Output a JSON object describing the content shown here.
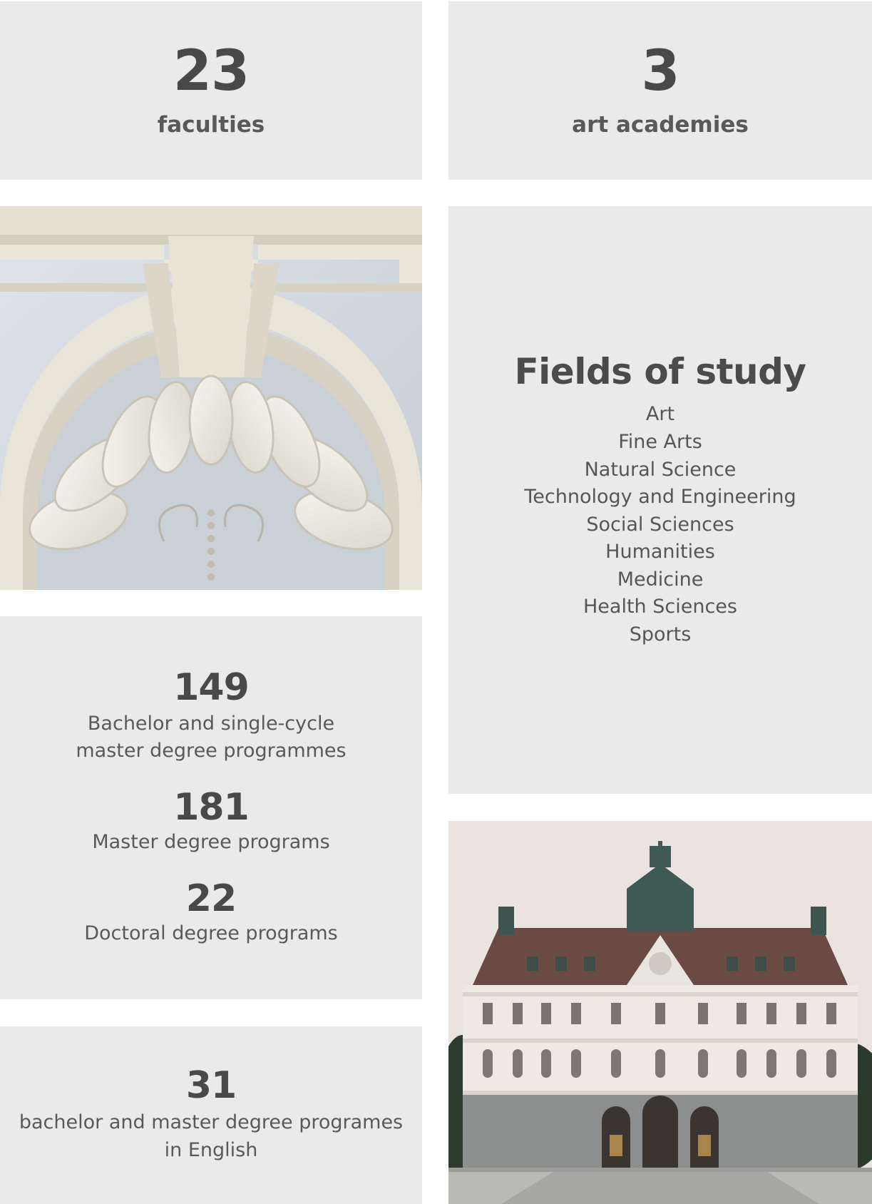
{
  "stats": {
    "faculties": {
      "number": "23",
      "label": "faculties"
    },
    "academies": {
      "number": "3",
      "label": "art academies"
    }
  },
  "fields": {
    "title": "Fields of study",
    "items": [
      "Art",
      "Fine Arts",
      "Natural Science",
      "Technology and Engineering",
      "Social Sciences",
      "Humanities",
      "Medicine",
      "Health Sciences",
      "Sports"
    ]
  },
  "programs": {
    "bachelor": {
      "number": "149",
      "label": "Bachelor and single-cycle master degree programmes"
    },
    "master": {
      "number": "181",
      "label": "Master degree programs"
    },
    "doctoral": {
      "number": "22",
      "label": "Doctoral degree programs"
    }
  },
  "english": {
    "number": "31",
    "label": "bachelor and master degree programes in English"
  },
  "colors": {
    "card_background": "#eaeaea",
    "text": "#4a4b4d",
    "page_background": "#ffffff"
  },
  "images": {
    "shell": "decorative-shell-relief-photo",
    "building": "university-building-photo"
  }
}
